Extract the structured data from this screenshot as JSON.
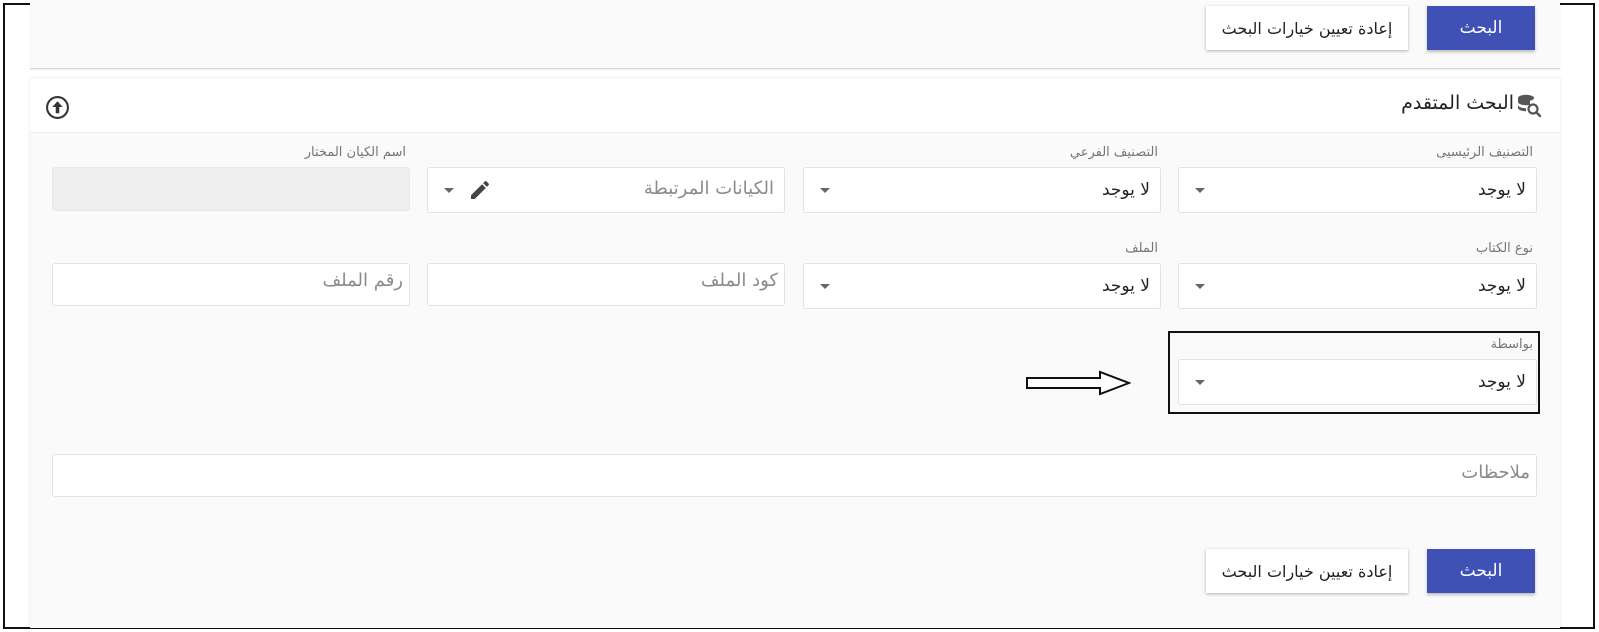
{
  "top_bar": {
    "search_label": "البحث",
    "reset_label": "إعادة تعيين خيارات البحث"
  },
  "advanced": {
    "title": "البحث المتقدم",
    "title_icon": "database-search-icon",
    "collapse_icon": "arrow-up-circle-icon"
  },
  "row1": {
    "main_category": {
      "label": "التصنيف الرئيسيى",
      "value": "لا يوجد"
    },
    "sub_category": {
      "label": "التصنيف الفرعي",
      "value": "لا يوجد"
    },
    "related_entities": {
      "placeholder": "الكيانات المرتبطة"
    },
    "selected_entity": {
      "label": "اسم الكيان المختار",
      "value": ""
    }
  },
  "row2": {
    "book_type": {
      "label": "نوع الكتاب",
      "value": "لا يوجد"
    },
    "file": {
      "label": "الملف",
      "value": "لا يوجد"
    },
    "file_code": {
      "placeholder": "كود الملف"
    },
    "file_number": {
      "placeholder": "رقم الملف"
    }
  },
  "row3": {
    "by": {
      "label": "بواسطة",
      "value": "لا يوجد"
    }
  },
  "notes": {
    "placeholder": "ملاحظات"
  },
  "bottom_bar": {
    "search_label": "البحث",
    "reset_label": "إعادة تعيين خيارات البحث"
  },
  "colors": {
    "primary": "#3f51b5",
    "annotation": "#111111"
  }
}
